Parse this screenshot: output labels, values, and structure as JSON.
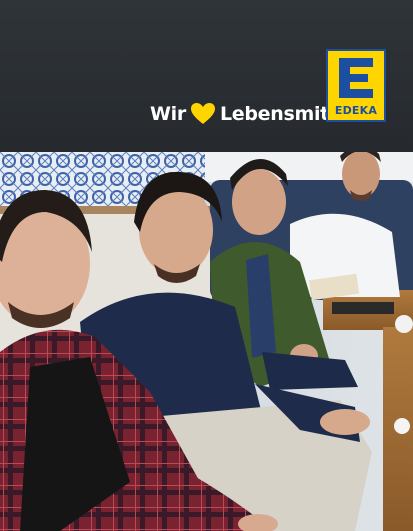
{
  "banner": {
    "slogan_pre": "Wir",
    "slogan_post": "Lebensmittel",
    "slogan_dot": ".",
    "heart_icon": "heart-icon",
    "heart_color": "#ffd500",
    "background_color": "#2b3034"
  },
  "logo": {
    "letter": "E",
    "wordmark": "EDEKA",
    "yellow": "#ffd500",
    "blue": "#1d4fa0"
  },
  "photo": {
    "scene": "four-people-at-cafe-table"
  }
}
